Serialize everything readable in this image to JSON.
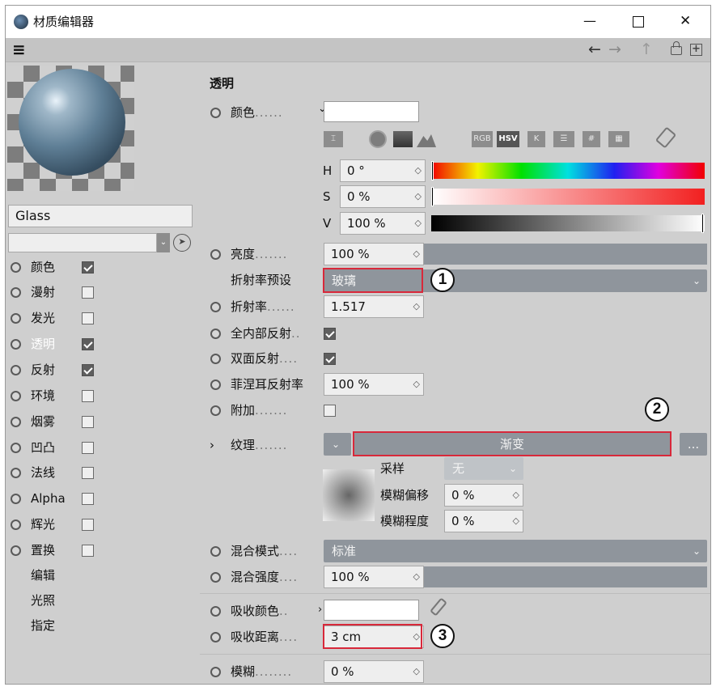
{
  "window": {
    "title": "材质编辑器",
    "minimize": "—",
    "maximize": "☐",
    "close": "✕"
  },
  "toolbar": {
    "menu": "≡",
    "back": "←",
    "forward": "→",
    "up": "↑",
    "lock": "🔒",
    "new": "⊞"
  },
  "material_name": "Glass",
  "channels": [
    {
      "label": "颜色",
      "checked": true
    },
    {
      "label": "漫射",
      "checked": false
    },
    {
      "label": "发光",
      "checked": false
    },
    {
      "label": "透明",
      "checked": true,
      "active": true
    },
    {
      "label": "反射",
      "checked": true
    },
    {
      "label": "环境",
      "checked": false
    },
    {
      "label": "烟雾",
      "checked": false
    },
    {
      "label": "凹凸",
      "checked": false
    },
    {
      "label": "法线",
      "checked": false
    },
    {
      "label": "Alpha",
      "checked": false
    },
    {
      "label": "辉光",
      "checked": false
    },
    {
      "label": "置换",
      "checked": false
    }
  ],
  "extra_items": [
    "编辑",
    "光照",
    "指定"
  ],
  "panel": {
    "section_title": "透明",
    "color_label": "颜色",
    "color_mode_buttons": [
      "RGB",
      "HSV",
      "K",
      "",
      "#",
      ""
    ],
    "h_label": "H",
    "h_value": "0 °",
    "s_label": "S",
    "s_value": "0 %",
    "v_label": "V",
    "v_value": "100 %",
    "brightness_label": "亮度",
    "brightness_value": "100 %",
    "ior_preset_label": "折射率预设",
    "ior_preset_value": "玻璃",
    "ior_label": "折射率",
    "ior_value": "1.517",
    "total_internal_label": "全内部反射",
    "total_internal": true,
    "double_sided_label": "双面反射",
    "double_sided": true,
    "fresnel_label": "菲涅耳反射率",
    "fresnel_value": "100 %",
    "additive_label": "附加",
    "additive": false,
    "texture_label": "纹理",
    "texture_value": "渐变",
    "texture_more": "...",
    "sampling_label": "采样",
    "sampling_value": "无",
    "blur_offset_label": "模糊偏移",
    "blur_offset_value": "0 %",
    "blur_scale_label": "模糊程度",
    "blur_scale_value": "0 %",
    "mix_mode_label": "混合模式",
    "mix_mode_value": "标准",
    "mix_strength_label": "混合强度",
    "mix_strength_value": "100 %",
    "absorption_color_label": "吸收颜色",
    "absorption_distance_label": "吸收距离",
    "absorption_distance_value": "3 cm",
    "blur_label": "模糊",
    "blur_value": "0 %"
  },
  "callouts": [
    "1",
    "2",
    "3"
  ],
  "colors": {
    "panel_bg": "#cfcfcf",
    "dropdown": "#8f959c",
    "highlight": "#d8283a",
    "active_text": "#ffffff"
  }
}
